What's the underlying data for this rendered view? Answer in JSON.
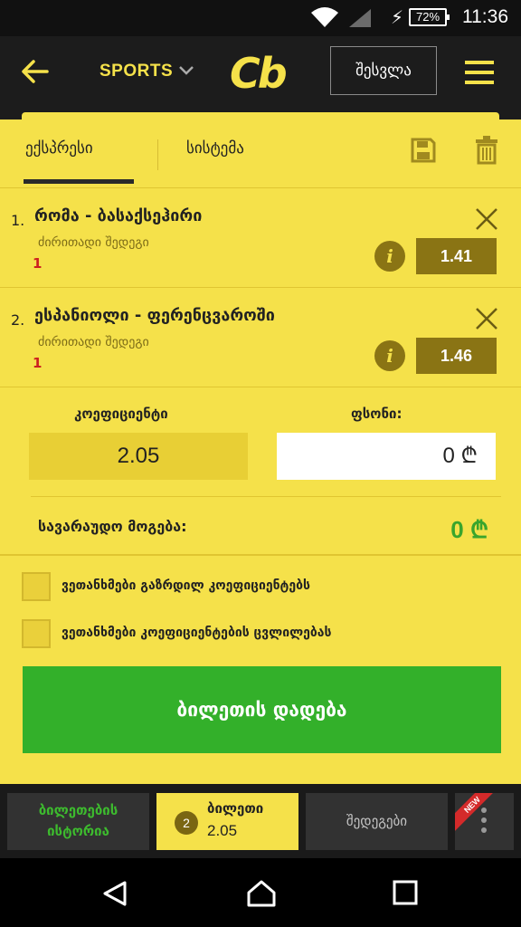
{
  "status_bar": {
    "battery": "72%",
    "time": "11:36"
  },
  "header": {
    "sports_label": "SPORTS",
    "logo": "Cb",
    "login_label": "შესვლა"
  },
  "tabs": {
    "express": "ექსპრესი",
    "system": "სისტემა"
  },
  "bets": [
    {
      "index": "1.",
      "title": "რომა - ბასაქსეჰირი",
      "market": "ძირითადი შედეგი",
      "pick": "1",
      "odd": "1.41"
    },
    {
      "index": "2.",
      "title": "ესპანიოლი - ფერენცვაროში",
      "market": "ძირითადი შედეგი",
      "pick": "1",
      "odd": "1.46"
    }
  ],
  "stake": {
    "coefficient_label": "კოეფიციენტი",
    "coefficient_value": "2.05",
    "stake_label": "ფსონი:",
    "stake_value": "0 ₾",
    "win_label": "სავარაუდო მოგება:",
    "win_value": "0 ₾"
  },
  "options": {
    "agree_increased": "ვეთანხმები გაზრდილ კოეფიციენტებს",
    "agree_changes": "ვეთანხმები კოეფიციენტების ცვლილებას"
  },
  "place_bet_label": "ბილეთის დადება",
  "bottom_nav": {
    "history_line1": "ბილეთების",
    "history_line2": "ისტორია",
    "ticket_count": "2",
    "ticket_label": "ბილეთი",
    "ticket_value": "2.05",
    "results_label": "შედეგები",
    "new_badge": "NEW"
  },
  "colors": {
    "accent": "#f5e14a",
    "header": "#1c1c1c",
    "green": "#33b02a",
    "odd_bg": "#8a7414",
    "pick_red": "#cc1f1f"
  },
  "icons": [
    "wifi-icon",
    "signal-icon",
    "battery-icon",
    "back-arrow-icon",
    "chevron-down-icon",
    "menu-icon",
    "save-icon",
    "trash-icon",
    "close-icon",
    "info-icon",
    "more-icon",
    "nav-back-icon",
    "nav-home-icon",
    "nav-recents-icon"
  ]
}
